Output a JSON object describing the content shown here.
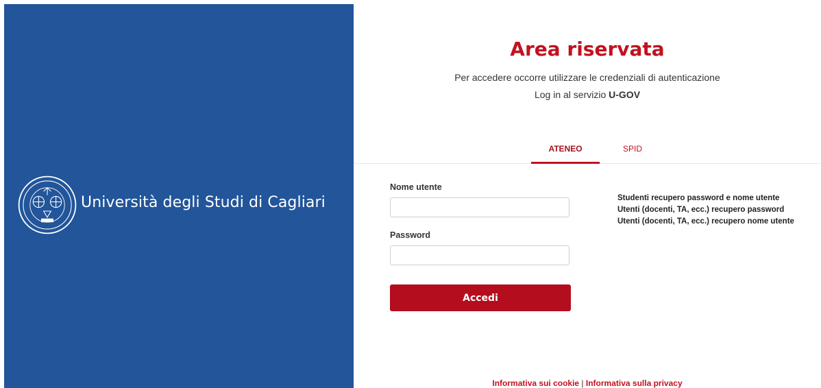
{
  "brand": {
    "name": "Università degli Studi di Cagliari",
    "logo_icon": "university-seal-icon",
    "panel_color": "#22559a"
  },
  "header": {
    "title": "Area riservata",
    "subtitle": "Per accedere occorre utilizzare le credenziali di autenticazione",
    "service_prefix": "Log in al servizio",
    "service_name": "U-GOV"
  },
  "tabs": [
    {
      "label": "ATENEO",
      "active": true
    },
    {
      "label": "SPID",
      "active": false
    }
  ],
  "form": {
    "username_label": "Nome utente",
    "username_value": "",
    "password_label": "Password",
    "password_value": "",
    "submit_label": "Accedi"
  },
  "help_links": [
    "Studenti recupero password e nome utente",
    "Utenti (docenti, TA, ecc.) recupero password",
    "Utenti (docenti, TA, ecc.) recupero nome utente"
  ],
  "footer": {
    "cookie_link": "Informativa sui cookie",
    "separator": "|",
    "privacy_link": "Informativa sulla privacy"
  },
  "colors": {
    "accent": "#c1121f",
    "button": "#b40d1e"
  }
}
